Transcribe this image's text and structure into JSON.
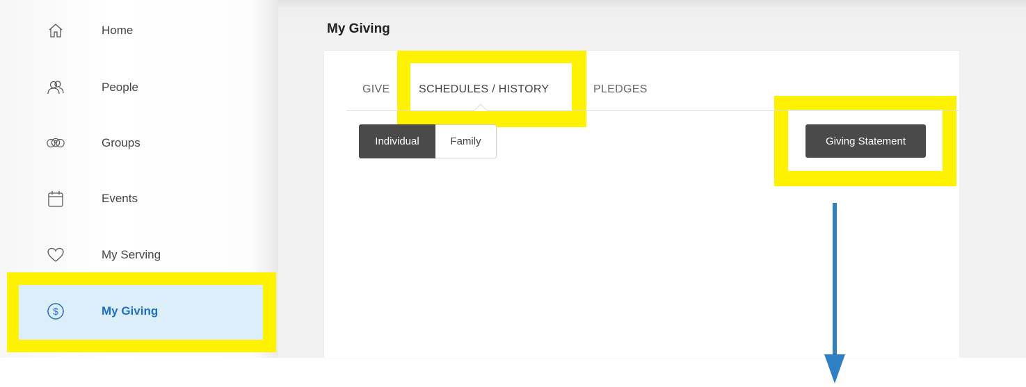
{
  "sidebar": {
    "items": [
      {
        "label": "Home",
        "icon": "home-icon"
      },
      {
        "label": "People",
        "icon": "people-icon"
      },
      {
        "label": "Groups",
        "icon": "groups-icon"
      },
      {
        "label": "Events",
        "icon": "calendar-icon"
      },
      {
        "label": "My Serving",
        "icon": "heart-icon"
      },
      {
        "label": "My Giving",
        "icon": "dollar-circle-icon",
        "active": true
      }
    ]
  },
  "main": {
    "title": "My Giving",
    "tabs": [
      {
        "label": "GIVE"
      },
      {
        "label": "SCHEDULES / HISTORY",
        "active": true
      },
      {
        "label": "PLEDGES"
      }
    ],
    "segments": [
      {
        "label": "Individual",
        "active": true
      },
      {
        "label": "Family"
      }
    ],
    "statement_button": "Giving Statement"
  },
  "colors": {
    "highlight": "#fff200",
    "accent": "#1e6fc2",
    "arrow": "#2e7fc4",
    "button_dark": "#4a4a4a"
  }
}
